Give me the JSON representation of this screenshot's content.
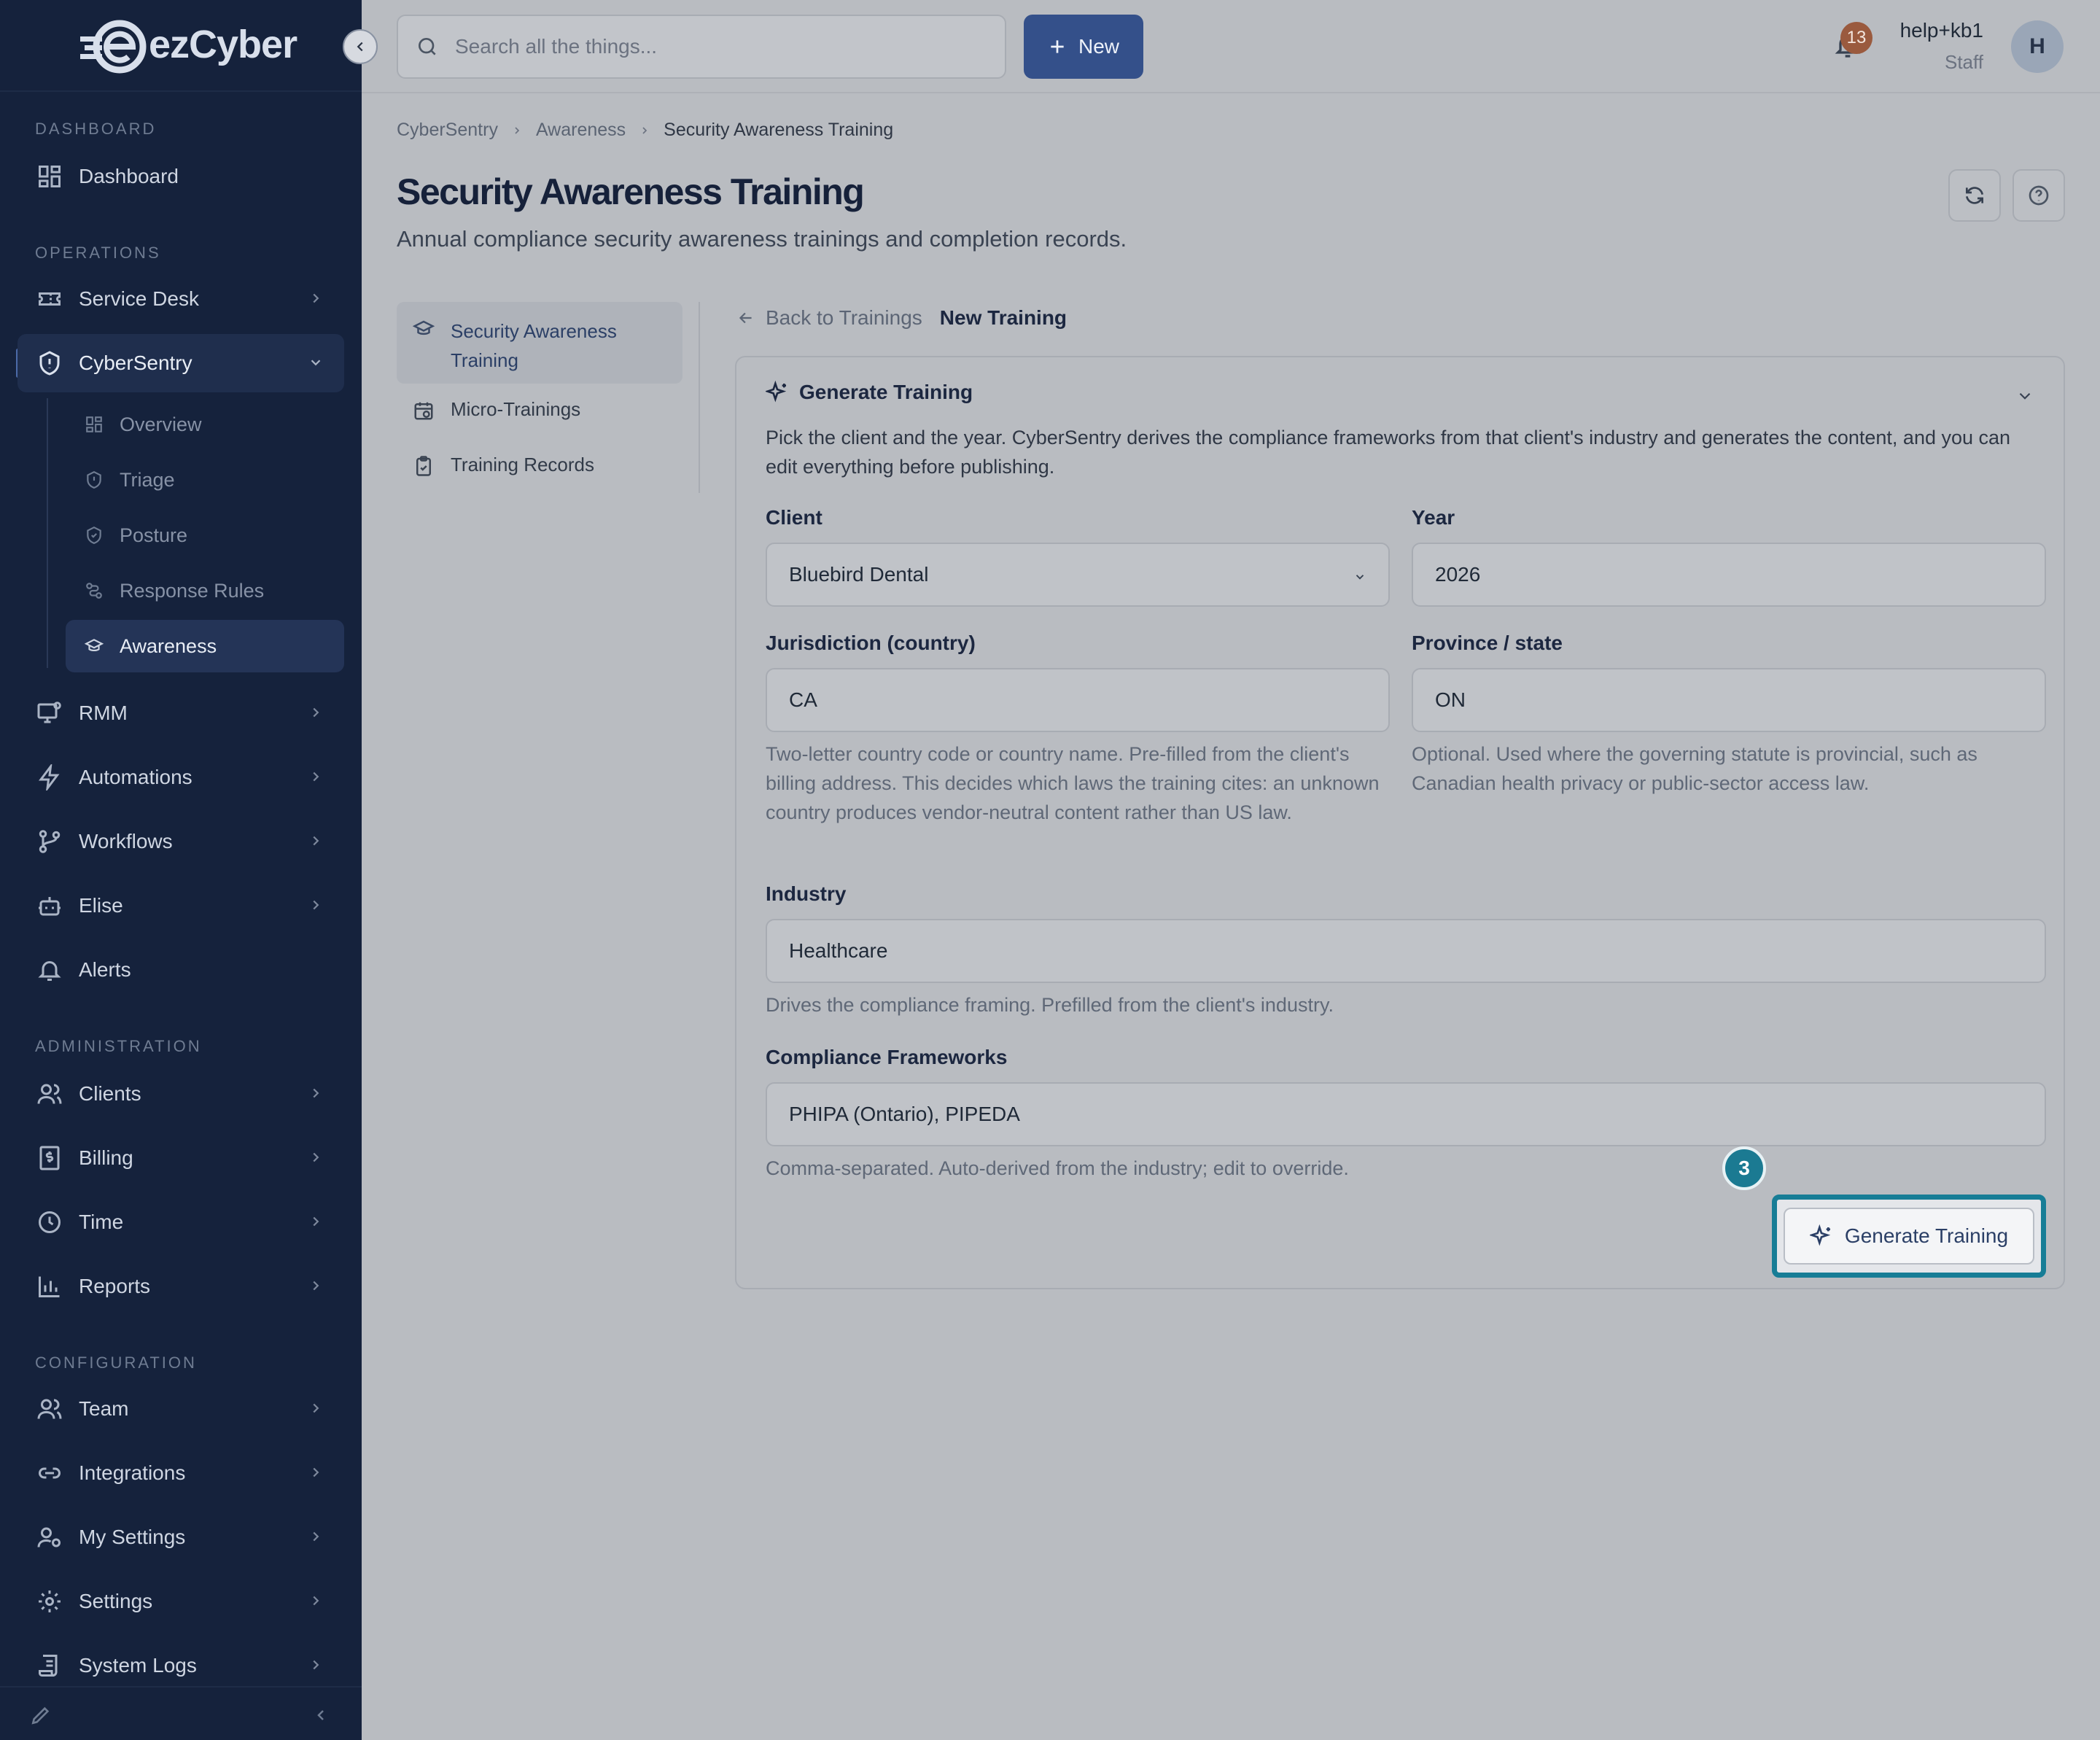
{
  "brand": {
    "logo_text": "ezCyber"
  },
  "sidebar": {
    "sections": {
      "dashboard": "DASHBOARD",
      "operations": "OPERATIONS",
      "administration": "ADMINISTRATION",
      "configuration": "CONFIGURATION"
    },
    "items": {
      "dashboard": "Dashboard",
      "service_desk": "Service Desk",
      "cybersentry": "CyberSentry",
      "rmm": "RMM",
      "automations": "Automations",
      "workflows": "Workflows",
      "elise": "Elise",
      "alerts": "Alerts",
      "clients": "Clients",
      "billing": "Billing",
      "time": "Time",
      "reports": "Reports",
      "team": "Team",
      "integrations": "Integrations",
      "my_settings": "My Settings",
      "settings": "Settings",
      "system_logs": "System Logs"
    },
    "cybersentry_sub": {
      "overview": "Overview",
      "triage": "Triage",
      "posture": "Posture",
      "response_rules": "Response Rules",
      "awareness": "Awareness"
    }
  },
  "topbar": {
    "search_placeholder": "Search all the things...",
    "new_label": "New",
    "notification_count": "13",
    "user_name": "help+kb1",
    "user_role": "Staff",
    "avatar_initial": "H"
  },
  "breadcrumb": [
    "CyberSentry",
    "Awareness",
    "Security Awareness Training"
  ],
  "page": {
    "title": "Security Awareness Training",
    "subtitle": "Annual compliance security awareness trainings and completion records."
  },
  "subnav": {
    "item1_line1": "Security Awareness",
    "item1_line2": "Training",
    "item2": "Micro-Trainings",
    "item3": "Training Records"
  },
  "back": {
    "link": "Back to Trainings",
    "current": "New Training"
  },
  "card": {
    "title": "Generate Training",
    "description": "Pick the client and the year. CyberSentry derives the compliance frameworks from that client's industry and generates the content, and you can edit everything before publishing.",
    "client_label": "Client",
    "client_value": "Bluebird Dental",
    "year_label": "Year",
    "year_value": "2026",
    "jurisdiction_label": "Jurisdiction (country)",
    "jurisdiction_value": "CA",
    "jurisdiction_help": "Two-letter country code or country name. Pre-filled from the client's billing address. This decides which laws the training cites: an unknown country produces vendor-neutral content rather than US law.",
    "province_label": "Province / state",
    "province_value": "ON",
    "province_help": "Optional. Used where the governing statute is provincial, such as Canadian health privacy or public-sector access law.",
    "industry_label": "Industry",
    "industry_value": "Healthcare",
    "industry_help": "Drives the compliance framing. Prefilled from the client's industry.",
    "frameworks_label": "Compliance Frameworks",
    "frameworks_value": "PHIPA (Ontario), PIPEDA",
    "frameworks_help": "Comma-separated. Auto-derived from the industry; edit to override.",
    "generate_label": "Generate Training",
    "step_number": "3"
  },
  "colors": {
    "sidebar_bg": "#15223c",
    "primary": "#34508a",
    "highlight": "#177d96"
  }
}
